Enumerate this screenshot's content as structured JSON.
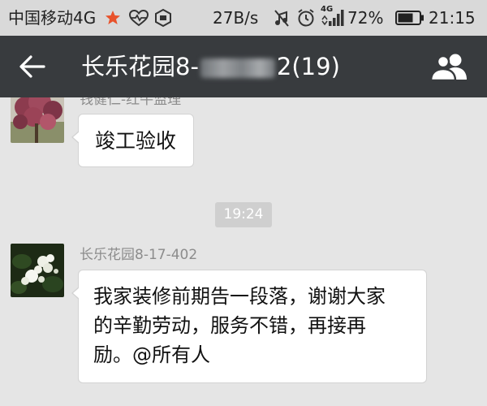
{
  "status_bar": {
    "carrier": "中国移动4G",
    "net_speed": "27B/s",
    "network_type": "4G",
    "battery_percent": "72%",
    "time": "21:15",
    "battery_level": 0.72,
    "icons": [
      "star-icon",
      "heart-rate-icon",
      "hexagon-icon",
      "mute-icon",
      "alarm-icon",
      "signal-icon",
      "battery-icon"
    ]
  },
  "header": {
    "title_start": "长乐花园8-",
    "title_end": "2(19)",
    "back_icon": "back-arrow-icon",
    "members_icon": "group-members-icon"
  },
  "messages": [
    {
      "sender": "钱健仁-红牛监理",
      "text": "竣工验收",
      "avatar": "flower-tree-avatar"
    },
    {
      "timestamp": "19:24"
    },
    {
      "sender": "长乐花园8-17-402",
      "lines": [
        "我家装修前期告一段落，谢谢大家",
        "的辛勤劳动，服务不错，再接再",
        "励。@所有人"
      ],
      "avatar": "white-flower-avatar"
    }
  ],
  "colors": {
    "title_bar": "#383b3e",
    "status_bar": "#d9d9d9",
    "chat_background": "#e5e5e5",
    "bubble": "#ffffff",
    "sender_text": "#8c8c8c",
    "timestamp_pill": "#cfcfcf"
  }
}
